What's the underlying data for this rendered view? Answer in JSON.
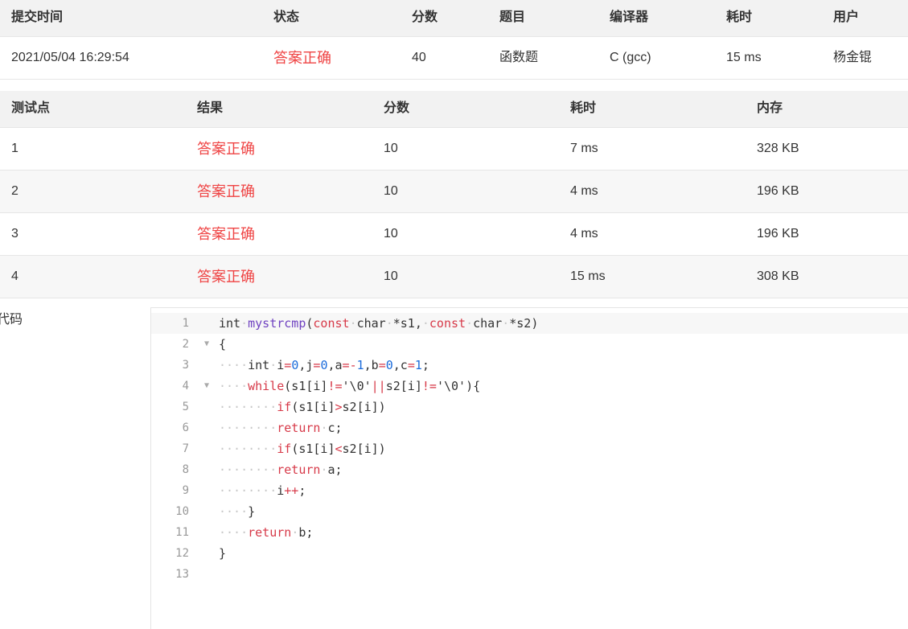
{
  "submission": {
    "headers": [
      "提交时间",
      "状态",
      "分数",
      "题目",
      "编译器",
      "耗时",
      "用户"
    ],
    "row": {
      "time": "2021/05/04 16:29:54",
      "status": "答案正确",
      "score": "40",
      "problem": "函数题",
      "compiler": "C (gcc)",
      "duration": "15 ms",
      "user": "杨金锟"
    }
  },
  "testcases": {
    "headers": [
      "测试点",
      "结果",
      "分数",
      "耗时",
      "内存"
    ],
    "rows": [
      {
        "id": "1",
        "result": "答案正确",
        "score": "10",
        "time": "7 ms",
        "memory": "328 KB"
      },
      {
        "id": "2",
        "result": "答案正确",
        "score": "10",
        "time": "4 ms",
        "memory": "196 KB"
      },
      {
        "id": "3",
        "result": "答案正确",
        "score": "10",
        "time": "4 ms",
        "memory": "196 KB"
      },
      {
        "id": "4",
        "result": "答案正确",
        "score": "10",
        "time": "15 ms",
        "memory": "308 KB"
      }
    ]
  },
  "code": {
    "label": "代码",
    "lines": [
      "int mystrcmp(const char *s1, const char *s2)",
      "{",
      "    int i=0,j=0,a=-1,b=0,c=1;",
      "    while(s1[i]!='\\0'||s2[i]!='\\0'){",
      "        if(s1[i]>s2[i])",
      "        return c;",
      "        if(s1[i]<s2[i])",
      "        return a;",
      "        i++;",
      "    }",
      "    return b;",
      "}",
      ""
    ],
    "fold_lines": [
      2,
      4
    ]
  },
  "colors": {
    "accepted": "#ef4444",
    "header_bg": "#f2f2f2",
    "keyword": "#d73a49",
    "number": "#1a6bdb",
    "function": "#6f42c1"
  }
}
